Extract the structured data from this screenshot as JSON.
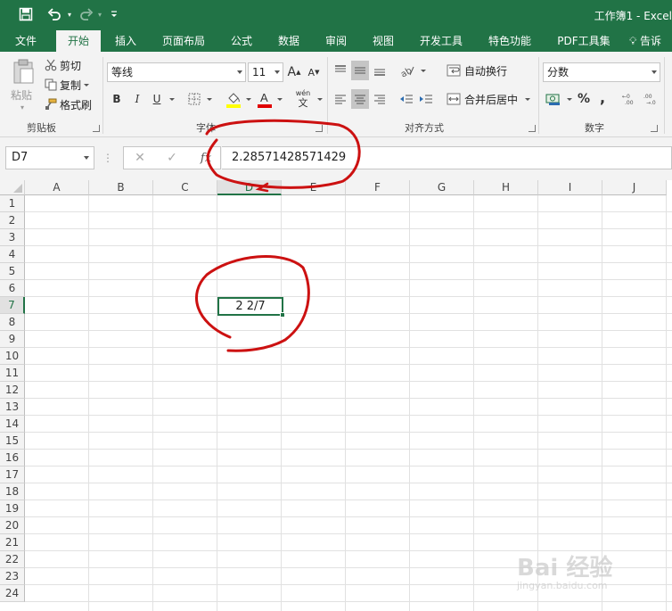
{
  "app": {
    "title": "工作簿1 - Excel",
    "accent_color": "#217346"
  },
  "quick_access": {
    "items": [
      "save-icon",
      "undo-icon",
      "redo-icon",
      "customize-icon"
    ]
  },
  "tabs": [
    {
      "label": "文件"
    },
    {
      "label": "开始",
      "active": true
    },
    {
      "label": "插入"
    },
    {
      "label": "页面布局"
    },
    {
      "label": "公式"
    },
    {
      "label": "数据"
    },
    {
      "label": "审阅"
    },
    {
      "label": "视图"
    },
    {
      "label": "开发工具"
    },
    {
      "label": "特色功能"
    },
    {
      "label": "PDF工具集"
    },
    {
      "label": "告诉"
    }
  ],
  "ribbon": {
    "clipboard": {
      "paste": "粘贴",
      "cut": "剪切",
      "copy": "复制",
      "format_painter": "格式刷",
      "group_label": "剪贴板"
    },
    "font": {
      "font_name": "等线",
      "font_size": "11",
      "bold": "B",
      "italic": "I",
      "underline": "U",
      "wen": "wén",
      "group_label": "字体"
    },
    "alignment": {
      "wrap_text": "自动换行",
      "merge_center": "合并后居中",
      "group_label": "对齐方式"
    },
    "number": {
      "format": "分数",
      "percent": "%",
      "comma": ",",
      "group_label": "数字"
    }
  },
  "formula_bar": {
    "name_box": "D7",
    "formula": "2.28571428571429"
  },
  "sheet": {
    "columns": [
      "A",
      "B",
      "C",
      "D",
      "E",
      "F",
      "G",
      "H",
      "I",
      "J"
    ],
    "selected_column": "D",
    "rows": [
      "1",
      "2",
      "3",
      "4",
      "5",
      "6",
      "7",
      "8",
      "9",
      "10",
      "11",
      "12",
      "13",
      "14",
      "15",
      "16",
      "17",
      "18",
      "19",
      "20",
      "21",
      "22",
      "23",
      "24"
    ],
    "selected_row": "7",
    "active_cell_value": "2 2/7"
  },
  "watermark": {
    "text": "Bai 经验",
    "url": "jingyan.baidu.com"
  }
}
